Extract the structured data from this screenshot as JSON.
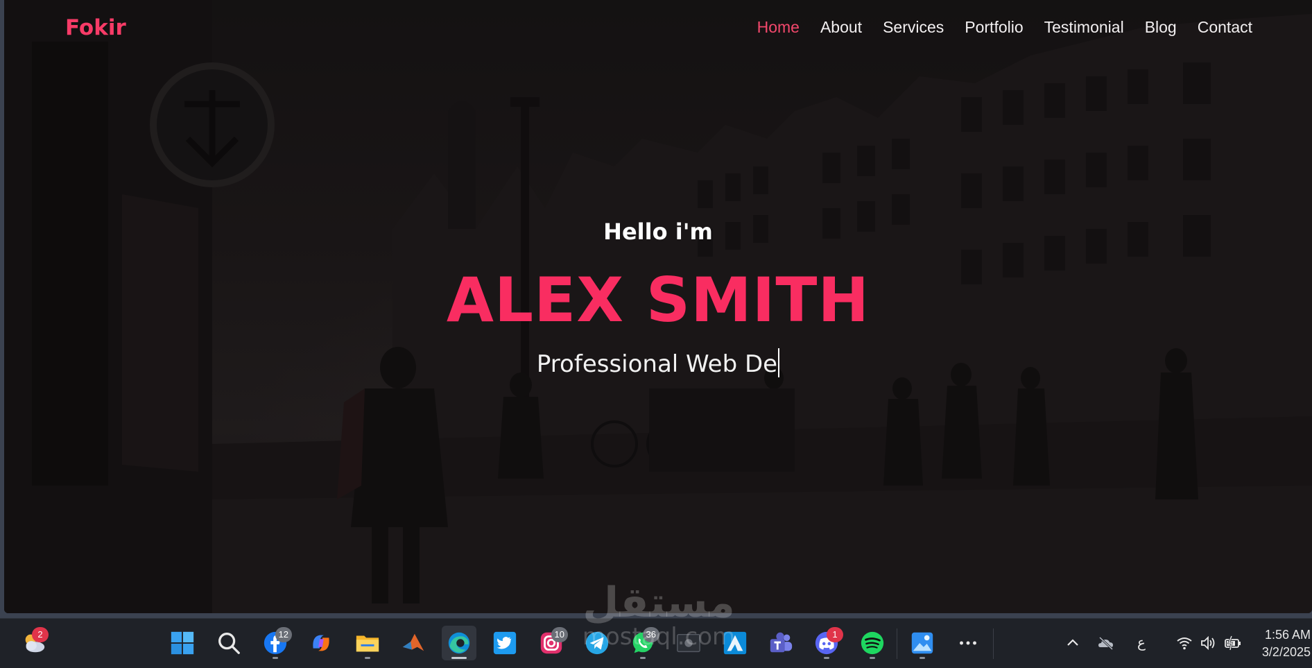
{
  "site": {
    "logo": "Fokir",
    "nav": [
      {
        "label": "Home",
        "active": true
      },
      {
        "label": "About",
        "active": false
      },
      {
        "label": "Services",
        "active": false
      },
      {
        "label": "Portfolio",
        "active": false
      },
      {
        "label": "Testimonial",
        "active": false
      },
      {
        "label": "Blog",
        "active": false
      },
      {
        "label": "Contact",
        "active": false
      }
    ],
    "hero": {
      "greeting": "Hello i'm",
      "name": "ALEX SMITH",
      "tagline_typed": "Professional Web De"
    },
    "colors": {
      "accent": "#f92d61",
      "nav_active": "#f3486c"
    }
  },
  "watermark": {
    "arabic": "مستقل",
    "latin": "mostaql.com"
  },
  "taskbar": {
    "weather_badge": "2",
    "apps": [
      {
        "name": "windows-start-icon"
      },
      {
        "name": "search-icon"
      },
      {
        "name": "facebook-icon",
        "badge": "12"
      },
      {
        "name": "copilot-icon"
      },
      {
        "name": "file-explorer-icon"
      },
      {
        "name": "matlab-icon"
      },
      {
        "name": "edge-icon"
      },
      {
        "name": "twitter-icon"
      },
      {
        "name": "instagram-icon",
        "badge": "10"
      },
      {
        "name": "telegram-icon"
      },
      {
        "name": "whatsapp-icon",
        "badge": "36"
      },
      {
        "name": "screen-recorder-icon"
      },
      {
        "name": "autodesk-icon"
      },
      {
        "name": "teams-icon"
      },
      {
        "name": "discord-icon",
        "badge": "1"
      },
      {
        "name": "spotify-icon"
      },
      {
        "name": "photos-icon"
      },
      {
        "name": "more-icon"
      }
    ],
    "tray": {
      "language": "ع",
      "time": "1:56 AM",
      "date": "3/2/2025"
    }
  }
}
